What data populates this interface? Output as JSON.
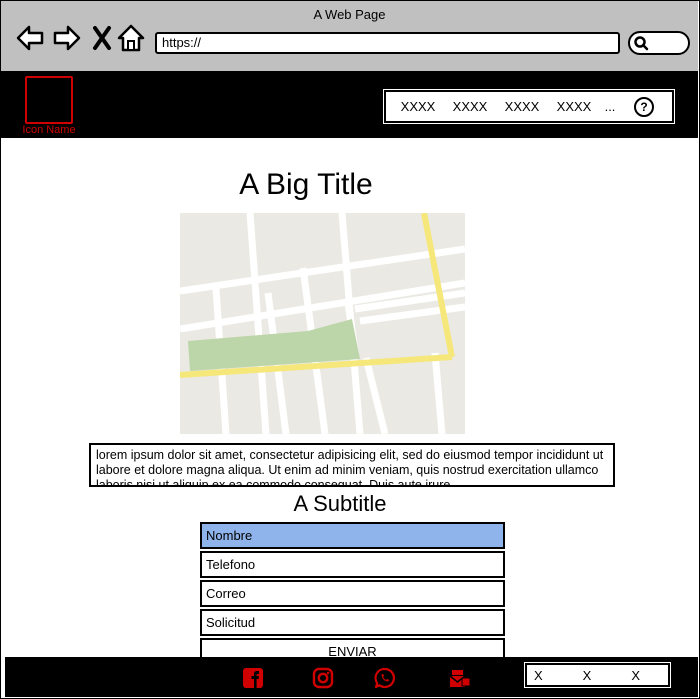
{
  "window": {
    "title": "A Web Page"
  },
  "browser": {
    "url": "https://",
    "icons": [
      "back-arrow-icon",
      "forward-arrow-icon",
      "close-icon",
      "home-icon",
      "search-icon"
    ]
  },
  "header": {
    "logo_label": "Icon Name",
    "nav": {
      "items": [
        "XXXX",
        "XXXX",
        "XXXX",
        "XXXX"
      ],
      "more": "...",
      "help": "?"
    }
  },
  "main": {
    "title": "A Big Title",
    "paragraph": "lorem ipsum dolor sit amet, consectetur adipisicing elit, sed do eiusmod tempor incididunt ut labore et dolore magna aliqua. Ut enim ad minim veniam, quis nostrud exercitation ullamco laboris nisi ut aliquip ex ea commodo consequat. Duis aute irure",
    "subtitle": "A Subtitle",
    "form": {
      "fields": [
        "Nombre",
        "Telefono",
        "Correo",
        "Solicitud"
      ],
      "submit": "ENVIAR"
    }
  },
  "footer": {
    "social_icons": [
      "facebook-icon",
      "instagram-icon",
      "whatsapp-icon",
      "mail-icon"
    ],
    "links": [
      "X",
      "X",
      "X"
    ]
  },
  "colors": {
    "accent_red": "#d10000",
    "active_field": "#8fb4ec",
    "chrome_gray": "#c0c0c0",
    "map_road_yellow": "#f5e77a",
    "map_park_green": "#bcd5a9",
    "map_bg": "#ebe9e3"
  }
}
